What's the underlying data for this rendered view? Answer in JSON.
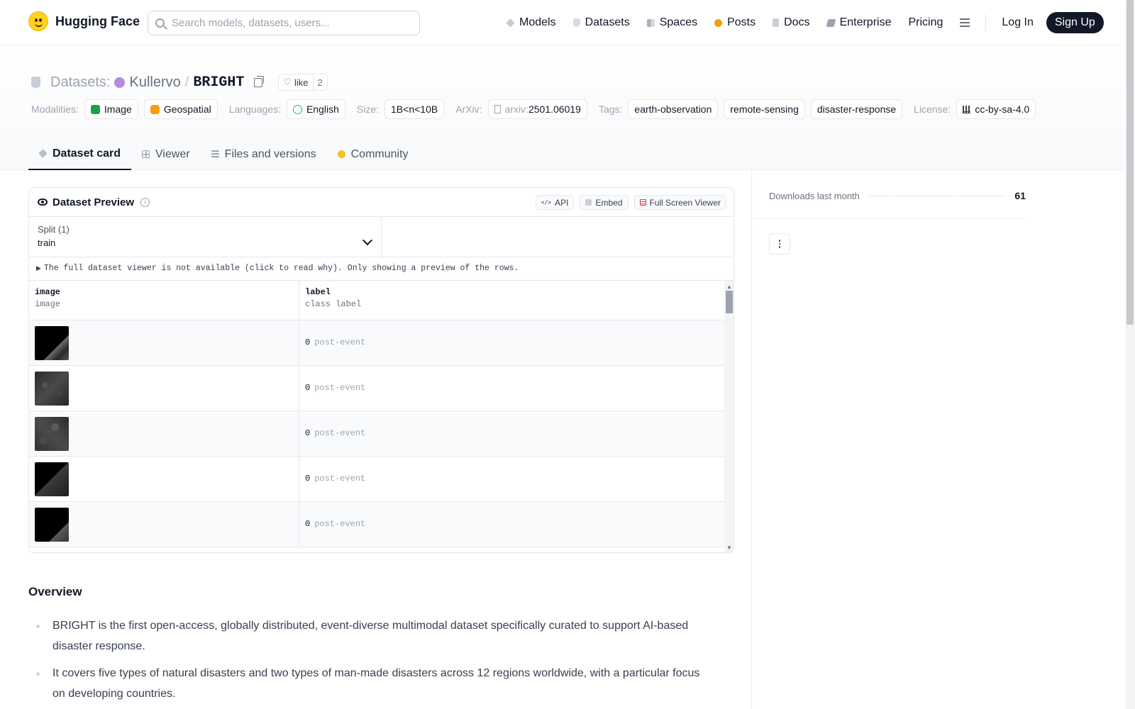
{
  "nav": {
    "brand": "Hugging Face",
    "search_placeholder": "Search models, datasets, users...",
    "links": [
      {
        "label": "Models",
        "icon": "models-icon"
      },
      {
        "label": "Datasets",
        "icon": "datasets-icon"
      },
      {
        "label": "Spaces",
        "icon": "spaces-icon"
      },
      {
        "label": "Posts",
        "icon": "posts-icon"
      },
      {
        "label": "Docs",
        "icon": "docs-icon"
      },
      {
        "label": "Enterprise",
        "icon": "enterprise-icon"
      },
      {
        "label": "Pricing",
        "icon": ""
      }
    ],
    "login": "Log In",
    "signup": "Sign Up"
  },
  "header": {
    "section": "Datasets:",
    "owner": "Kullervo",
    "separator": "/",
    "name": "BRIGHT",
    "like_label": "like",
    "like_count": "2"
  },
  "tags": {
    "modalities_label": "Modalities:",
    "modalities": [
      "Image",
      "Geospatial"
    ],
    "languages_label": "Languages:",
    "language": "English",
    "size_label": "Size:",
    "size": "1B<n<10B",
    "arxiv_label": "ArXiv:",
    "arxiv_prefix": "arxiv:",
    "arxiv_id": "2501.06019",
    "tags_label": "Tags:",
    "tags": [
      "earth-observation",
      "remote-sensing",
      "disaster-response"
    ],
    "license_label": "License:",
    "license": "cc-by-sa-4.0"
  },
  "tabs": [
    {
      "label": "Dataset card",
      "active": true
    },
    {
      "label": "Viewer",
      "active": false
    },
    {
      "label": "Files and versions",
      "active": false
    },
    {
      "label": "Community",
      "active": false
    }
  ],
  "preview": {
    "title": "Dataset Preview",
    "info_glyph": "i",
    "buttons": {
      "api": "API",
      "embed": "Embed",
      "full": "Full Screen Viewer"
    },
    "split_label": "Split (1)",
    "split_value": "train",
    "notice": "The full dataset viewer is not available (click to read why). Only showing a preview of the rows.",
    "columns": [
      {
        "name": "image",
        "type": "image"
      },
      {
        "name": "label",
        "type": "class label"
      }
    ],
    "rows": [
      {
        "label_num": "0",
        "label_name": "post-event"
      },
      {
        "label_num": "0",
        "label_name": "post-event"
      },
      {
        "label_num": "0",
        "label_name": "post-event"
      },
      {
        "label_num": "0",
        "label_name": "post-event"
      },
      {
        "label_num": "0",
        "label_name": "post-event"
      }
    ]
  },
  "card": {
    "heading": "Overview",
    "bullets": [
      "BRIGHT is the first open-access, globally distributed, event-diverse multimodal dataset specifically curated to support AI-based disaster response.",
      "It covers five types of natural disasters and two types of man-made disasters across 12 regions worldwide, with a particular focus on developing countries."
    ]
  },
  "sidebar": {
    "downloads_label": "Downloads last month",
    "downloads_value": "61"
  }
}
